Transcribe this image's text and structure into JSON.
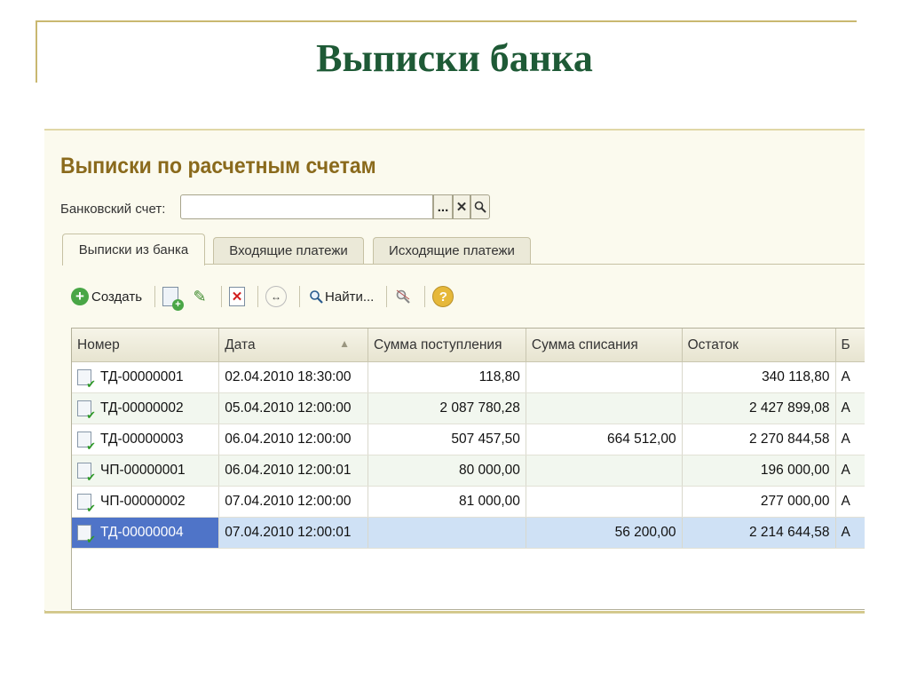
{
  "slide": {
    "title": "Выписки банка"
  },
  "form": {
    "title": "Выписки по расчетным счетам",
    "account": {
      "label": "Банковский счет:",
      "value": "",
      "select_label": "...",
      "clear_label": "✕",
      "search_icon": "search-icon"
    }
  },
  "tabs": [
    {
      "label": "Выписки из банка",
      "active": true
    },
    {
      "label": "Входящие платежи",
      "active": false
    },
    {
      "label": "Исходящие платежи",
      "active": false
    }
  ],
  "toolbar": {
    "create_label": "Создать",
    "find_label": "Найти...",
    "icons": [
      "plus-icon",
      "copy-icon",
      "pencil-icon",
      "delete-icon",
      "interval-icon",
      "find-icon",
      "clear-find-icon",
      "help-icon"
    ]
  },
  "grid": {
    "columns": [
      "Номер",
      "Дата",
      "Сумма поступления",
      "Сумма списания",
      "Остаток",
      "Б"
    ],
    "rows": [
      {
        "number": "ТД-00000001",
        "date": "02.04.2010 18:30:00",
        "income": "118,80",
        "expense": "",
        "balance": "340 118,80",
        "extra": "А"
      },
      {
        "number": "ТД-00000002",
        "date": "05.04.2010 12:00:00",
        "income": "2 087 780,28",
        "expense": "",
        "balance": "2 427 899,08",
        "extra": "А"
      },
      {
        "number": "ТД-00000003",
        "date": "06.04.2010 12:00:00",
        "income": "507 457,50",
        "expense": "664 512,00",
        "balance": "2 270 844,58",
        "extra": "А"
      },
      {
        "number": "ЧП-00000001",
        "date": "06.04.2010 12:00:01",
        "income": "80 000,00",
        "expense": "",
        "balance": "196 000,00",
        "extra": "А"
      },
      {
        "number": "ЧП-00000002",
        "date": "07.04.2010 12:00:00",
        "income": "81 000,00",
        "expense": "",
        "balance": "277 000,00",
        "extra": "А"
      },
      {
        "number": "ТД-00000004",
        "date": "07.04.2010 12:00:01",
        "income": "",
        "expense": "56 200,00",
        "balance": "2 214 644,58",
        "extra": "А",
        "selected": true
      }
    ]
  },
  "colors": {
    "title_green": "#1e5a36",
    "form_title": "#8a6a1c",
    "selection": "#4f74c8",
    "row_alt": "#f2f7ef"
  }
}
